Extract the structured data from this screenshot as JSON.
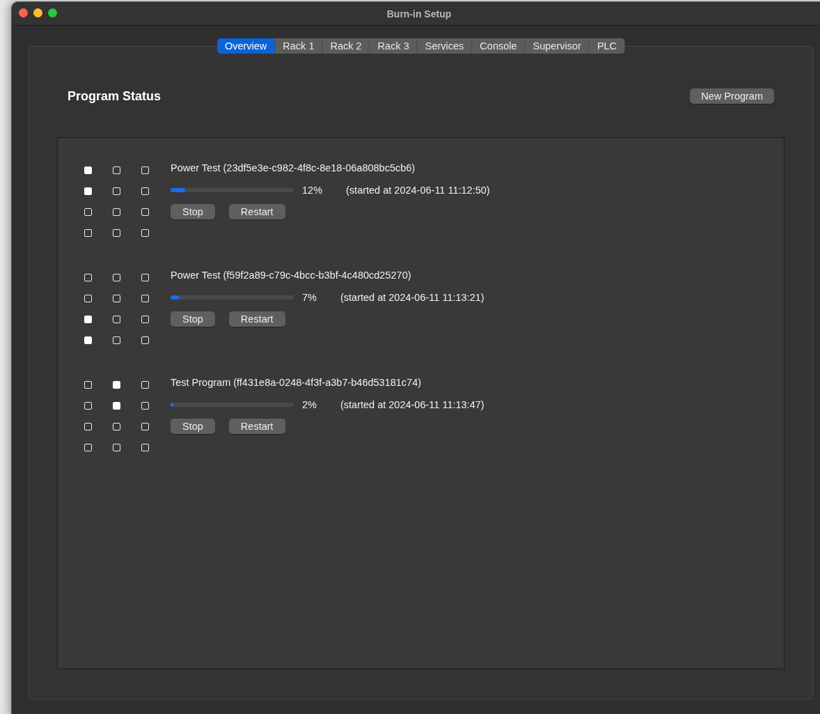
{
  "window": {
    "title": "Burn-in Setup"
  },
  "tabs": [
    {
      "label": "Overview",
      "selected": true
    },
    {
      "label": "Rack 1",
      "selected": false
    },
    {
      "label": "Rack 2",
      "selected": false
    },
    {
      "label": "Rack 3",
      "selected": false
    },
    {
      "label": "Services",
      "selected": false
    },
    {
      "label": "Console",
      "selected": false
    },
    {
      "label": "Supervisor",
      "selected": false
    },
    {
      "label": "PLC",
      "selected": false
    }
  ],
  "heading": "Program Status",
  "new_program_button": "New Program",
  "programs": [
    {
      "name": "Power Test (23df5e3e-c982-4f8c-8e18-06a808bc5cb6)",
      "level": 0.12,
      "percent": "12%",
      "started": "(started at 2024-06-11 11:12:50)",
      "slots": [
        [
          {
            "on": true
          },
          {
            "on": false
          },
          {
            "on": false
          }
        ],
        [
          {
            "on": true
          },
          {
            "on": false
          },
          {
            "on": false
          }
        ],
        [
          {
            "on": false
          },
          {
            "on": false
          },
          {
            "on": false
          }
        ],
        [
          {
            "on": false
          },
          {
            "on": false
          },
          {
            "on": false
          }
        ]
      ],
      "buttons": [
        "Stop",
        "Restart"
      ]
    },
    {
      "name": "Power Test (f59f2a89-c79c-4bcc-b3bf-4c480cd25270)",
      "level": 0.07,
      "percent": "7%",
      "started": "(started at 2024-06-11 11:13:21)",
      "slots": [
        [
          {
            "on": false
          },
          {
            "on": false
          },
          {
            "on": false
          }
        ],
        [
          {
            "on": false
          },
          {
            "on": false
          },
          {
            "on": false
          }
        ],
        [
          {
            "on": true
          },
          {
            "on": false
          },
          {
            "on": false
          }
        ],
        [
          {
            "on": true
          },
          {
            "on": false
          },
          {
            "on": false
          }
        ]
      ],
      "buttons": [
        "Stop",
        "Restart"
      ]
    },
    {
      "name": "Test Program (ff431e8a-0248-4f3f-a3b7-b46d53181c74)",
      "level": 0.02,
      "percent": "2%",
      "started": "(started at 2024-06-11 11:13:47)",
      "slots": [
        [
          {
            "on": false
          },
          {
            "on": true
          },
          {
            "on": false
          }
        ],
        [
          {
            "on": false
          },
          {
            "on": true
          },
          {
            "on": false
          }
        ],
        [
          {
            "on": false
          },
          {
            "on": false
          },
          {
            "on": false
          }
        ],
        [
          {
            "on": false
          },
          {
            "on": false
          },
          {
            "on": false
          }
        ]
      ],
      "buttons": [
        "Stop",
        "Restart"
      ]
    }
  ]
}
